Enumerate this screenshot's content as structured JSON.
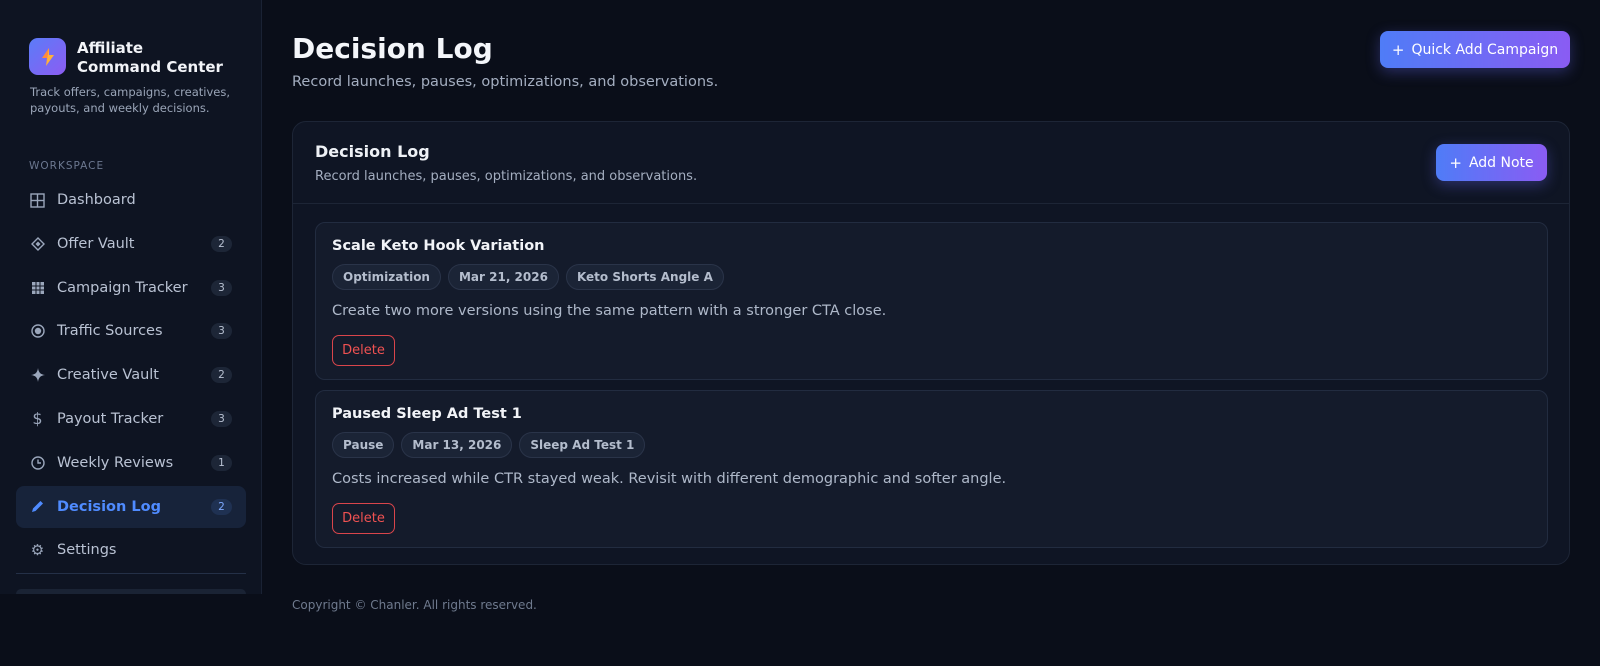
{
  "sidebar": {
    "brand_title": "Affiliate Command Center",
    "brand_desc": "Track offers, campaigns, creatives, payouts, and weekly decisions.",
    "section_label": "WORKSPACE",
    "items": [
      {
        "label": "Dashboard",
        "icon": "grid-icon",
        "badge": ""
      },
      {
        "label": "Offer Vault",
        "icon": "diamond-icon",
        "badge": "2"
      },
      {
        "label": "Campaign Tracker",
        "icon": "table-icon",
        "badge": "3"
      },
      {
        "label": "Traffic Sources",
        "icon": "target-icon",
        "badge": "3"
      },
      {
        "label": "Creative Vault",
        "icon": "sparkle-icon",
        "badge": "2"
      },
      {
        "label": "Payout Tracker",
        "icon": "dollar-icon",
        "badge": "3"
      },
      {
        "label": "Weekly Reviews",
        "icon": "clock-icon",
        "badge": "1"
      },
      {
        "label": "Decision Log",
        "icon": "pencil-icon",
        "badge": "2",
        "active": true
      },
      {
        "label": "Settings",
        "icon": "gear-icon",
        "badge": ""
      }
    ]
  },
  "header": {
    "title": "Decision Log",
    "subtitle": "Record launches, pauses, optimizations, and observations.",
    "quick_add_label": "Quick Add Campaign"
  },
  "card": {
    "title": "Decision Log",
    "subtitle": "Record launches, pauses, optimizations, and observations.",
    "add_note_label": "Add Note",
    "entries": [
      {
        "title": "Scale Keto Hook Variation",
        "type": "Optimization",
        "date": "Mar 21, 2026",
        "campaign": "Keto Shorts Angle A",
        "note": "Create two more versions using the same pattern with a stronger CTA close.",
        "delete_label": "Delete"
      },
      {
        "title": "Paused Sleep Ad Test 1",
        "type": "Pause",
        "date": "Mar 13, 2026",
        "campaign": "Sleep Ad Test 1",
        "note": "Costs increased while CTR stayed weak. Revisit with different demographic and softer angle.",
        "delete_label": "Delete"
      }
    ]
  },
  "footer": {
    "copyright": "Copyright © Chanler. All rights reserved."
  },
  "colors": {
    "accent": "#4f8bff",
    "gradient_start": "#4f7cf7",
    "gradient_end": "#8a5cf3",
    "danger": "#f05252"
  }
}
